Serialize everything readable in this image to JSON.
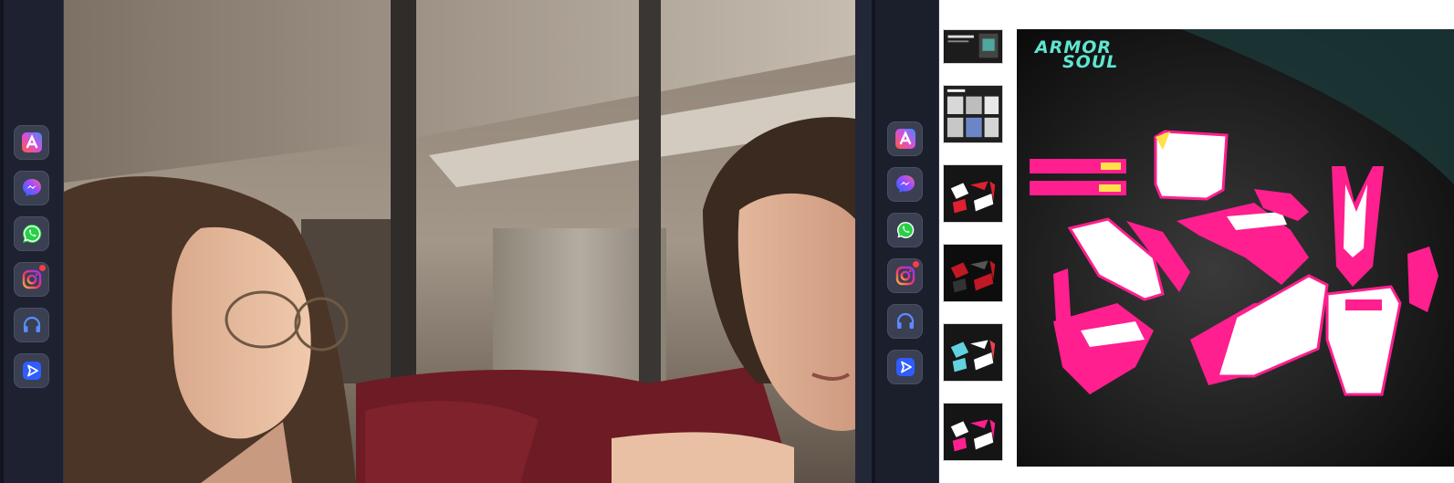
{
  "left_dock": {
    "apps": [
      {
        "name": "artstation-icon",
        "badge": false
      },
      {
        "name": "messenger-icon",
        "badge": false
      },
      {
        "name": "whatsapp-icon",
        "badge": false
      },
      {
        "name": "instagram-icon",
        "badge": true
      },
      {
        "name": "headphones-icon",
        "badge": false
      },
      {
        "name": "play-send-icon",
        "badge": false
      }
    ]
  },
  "product": {
    "brand_line1": "ARMOR",
    "brand_line2": "SOUL",
    "accent_color": "#ff1f8e",
    "brand_color": "#5ee6d0",
    "thumbnail_count": 6
  },
  "colors": {
    "dock_bg": "#1e2230",
    "app_tile": "#3a3f52"
  }
}
